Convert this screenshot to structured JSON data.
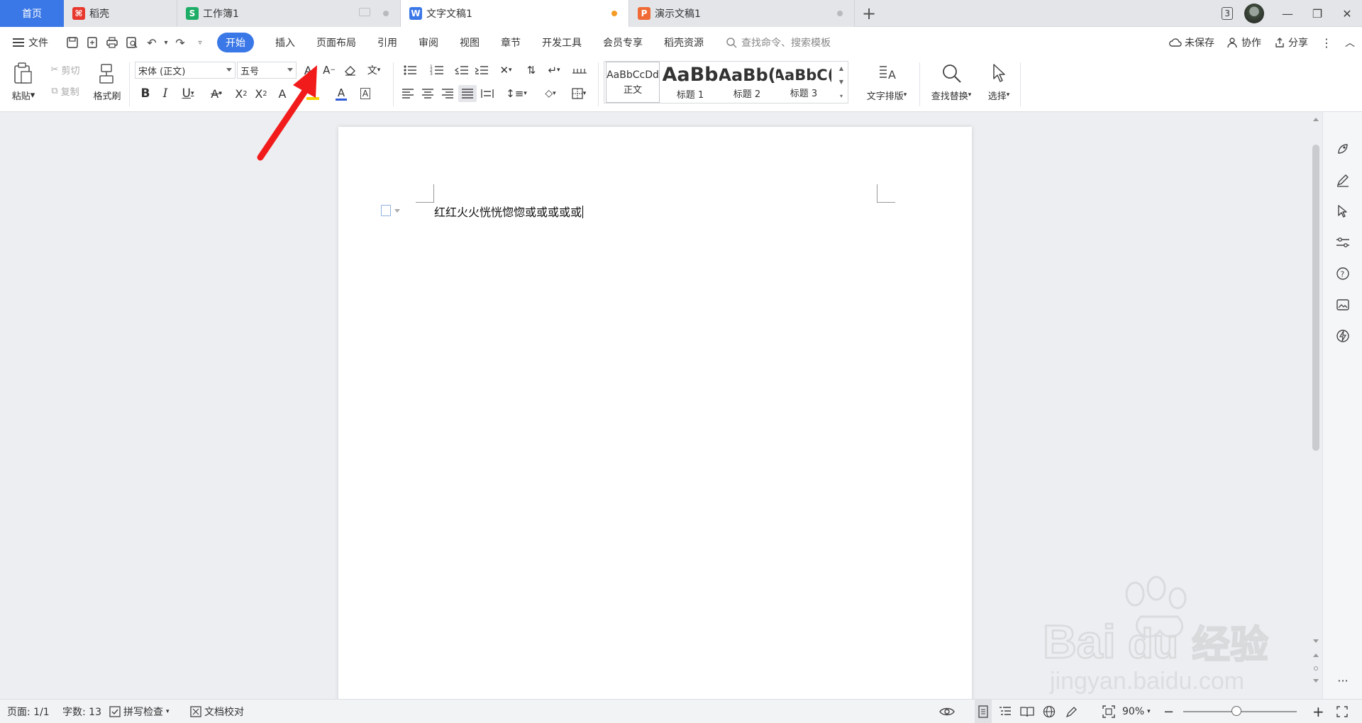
{
  "tabs": {
    "home": "首页",
    "daoke": "稻壳",
    "workbook": "工作簿1",
    "doc": "文字文稿1",
    "presentation": "演示文稿1",
    "add": "+",
    "badge_count": "3"
  },
  "menu": {
    "file": "文件",
    "tabs": [
      "开始",
      "插入",
      "页面布局",
      "引用",
      "审阅",
      "视图",
      "章节",
      "开发工具",
      "会员专享",
      "稻壳资源"
    ],
    "search_placeholder": "查找命令、搜索模板",
    "unsaved": "未保存",
    "collab": "协作",
    "share": "分享"
  },
  "ribbon": {
    "paste": "粘贴",
    "cut": "剪切",
    "copy": "复制",
    "format_painter": "格式刷",
    "font_name": "宋体 (正文)",
    "font_size": "五号",
    "styles": [
      {
        "sample": "AaBbCcDd",
        "label": "正文"
      },
      {
        "sample": "AaBb",
        "label": "标题 1"
      },
      {
        "sample": "AaBb(",
        "label": "标题 2"
      },
      {
        "sample": "AaBbC(",
        "label": "标题 3"
      }
    ],
    "text_layout": "文字排版",
    "find_replace": "查找替换",
    "select": "选择"
  },
  "document": {
    "text": "红红火火恍恍惚惚或或或或或"
  },
  "status": {
    "page": "页面: 1/1",
    "words": "字数: 13",
    "spell_check": "拼写检查",
    "proofread": "文档校对",
    "zoom": "90%"
  },
  "watermark": {
    "brand": "Bai",
    "brand2": "du",
    "cn": "经验",
    "url": "jingyan.baidu.com"
  },
  "colors": {
    "accent": "#3b78e7",
    "arrow": "#f21b1b",
    "font_color_bar": "#2f5bd8",
    "highlight_bar": "#f5d300"
  }
}
